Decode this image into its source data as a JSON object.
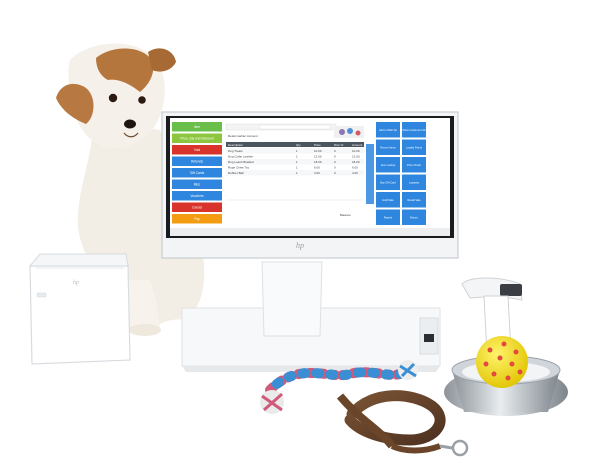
{
  "brand": {
    "logo": "hp"
  },
  "pos_screen": {
    "order_title": "Retail cashier Account",
    "left_buttons": [
      {
        "label": "Item",
        "color": "#6abf4b"
      },
      {
        "label": "Price, Qty and Discount",
        "color": "#8cc63f"
      },
      {
        "label": "Void",
        "color": "#d9342b"
      },
      {
        "label": "Refunds",
        "color": "#2e86de"
      },
      {
        "label": "Gift Cards",
        "color": "#2e86de"
      },
      {
        "label": "Misc",
        "color": "#2e86de"
      },
      {
        "label": "Vouchers",
        "color": "#2e86de"
      },
      {
        "label": "Cancel",
        "color": "#d9342b"
      },
      {
        "label": "Pay",
        "color": "#f39c12"
      }
    ],
    "table_headers": [
      "Description",
      "Qty",
      "Price",
      "Disc %",
      "Amount"
    ],
    "table_rows": [
      [
        "Dog Treats",
        "1",
        "10.00",
        "0",
        "10.00"
      ],
      [
        "Dog Collar Leather",
        "1",
        "12.00",
        "0",
        "12.00"
      ],
      [
        "Dog Leash Braided",
        "1",
        "18.00",
        "0",
        "18.00"
      ],
      [
        "Rope Chew Toy",
        "1",
        "6.00",
        "0",
        "6.00"
      ],
      [
        "Rubber Ball",
        "1",
        "4.00",
        "0",
        "4.00"
      ]
    ],
    "total_label": "Balance",
    "right_buttons": [
      "Add to Wish list",
      "Show Customer Info",
      "Recent Items",
      "Loyalty Points",
      "Item Lookup",
      "Price Check",
      "Buy Gift Card",
      "Layaway",
      "Hold Sale",
      "Recall Sale",
      "Reprint",
      "Return"
    ],
    "accent_color": "#2e86de"
  }
}
